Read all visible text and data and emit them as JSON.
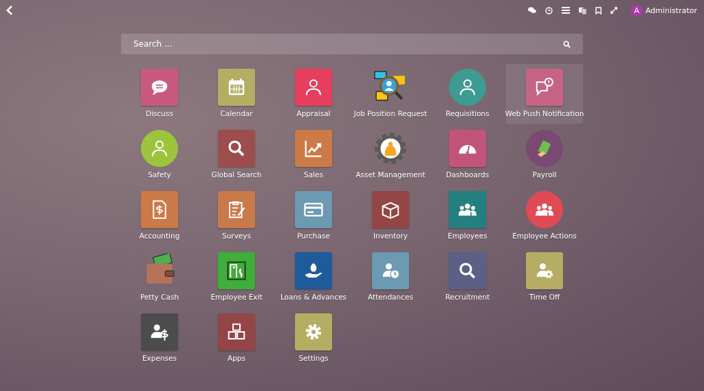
{
  "topbar": {
    "user": {
      "initial": "A",
      "name": "Administrator"
    }
  },
  "search": {
    "placeholder": "Search ..."
  },
  "apps": [
    {
      "label": "Discuss",
      "kind": "square",
      "color": "#c95a7e",
      "selected": false
    },
    {
      "label": "Calendar",
      "kind": "square",
      "color": "#b5ad64",
      "selected": false
    },
    {
      "label": "Appraisal",
      "kind": "square",
      "color": "#e63f5e",
      "selected": false
    },
    {
      "label": "Job Position Request",
      "kind": "picture",
      "color": "#f5c518",
      "selected": false
    },
    {
      "label": "Requisitions",
      "kind": "circle",
      "color": "#3d9b92",
      "selected": false
    },
    {
      "label": "Web Push Notification",
      "kind": "square",
      "color": "#c66485",
      "selected": true
    },
    {
      "label": "Safety",
      "kind": "circle",
      "color": "#9cc43c",
      "selected": false
    },
    {
      "label": "Global Search",
      "kind": "square",
      "color": "#9d4d4e",
      "selected": false
    },
    {
      "label": "Sales",
      "kind": "square",
      "color": "#cc7a48",
      "selected": false
    },
    {
      "label": "Asset Management",
      "kind": "picture",
      "color": "#5a5a5a",
      "selected": false
    },
    {
      "label": "Dashboards",
      "kind": "square",
      "color": "#c25379",
      "selected": false
    },
    {
      "label": "Payroll",
      "kind": "circle",
      "color": "#7a4a72",
      "selected": false
    },
    {
      "label": "Accounting",
      "kind": "square",
      "color": "#cc7a48",
      "selected": false
    },
    {
      "label": "Surveys",
      "kind": "square",
      "color": "#c97a4a",
      "selected": false
    },
    {
      "label": "Purchase",
      "kind": "square",
      "color": "#6c9ab3",
      "selected": false
    },
    {
      "label": "Inventory",
      "kind": "square",
      "color": "#944647",
      "selected": false
    },
    {
      "label": "Employees",
      "kind": "square",
      "color": "#24807f",
      "selected": false
    },
    {
      "label": "Employee Actions",
      "kind": "circle",
      "color": "#e04a55",
      "selected": false
    },
    {
      "label": "Petty Cash",
      "kind": "picture",
      "color": "#b5735a",
      "selected": false
    },
    {
      "label": "Employee Exit",
      "kind": "square",
      "color": "#3fae3a",
      "selected": false
    },
    {
      "label": "Loans & Advances",
      "kind": "square",
      "color": "#1f5a9b",
      "selected": false
    },
    {
      "label": "Attendances",
      "kind": "square",
      "color": "#6c9ab3",
      "selected": false
    },
    {
      "label": "Recruitment",
      "kind": "square",
      "color": "#5d5f86",
      "selected": false
    },
    {
      "label": "Time Off",
      "kind": "square",
      "color": "#b5ad64",
      "selected": false
    },
    {
      "label": "Expenses",
      "kind": "square",
      "color": "#4c4c4c",
      "selected": false
    },
    {
      "label": "Apps",
      "kind": "square",
      "color": "#944647",
      "selected": false
    },
    {
      "label": "Settings",
      "kind": "square",
      "color": "#b5ad64",
      "selected": false
    }
  ]
}
